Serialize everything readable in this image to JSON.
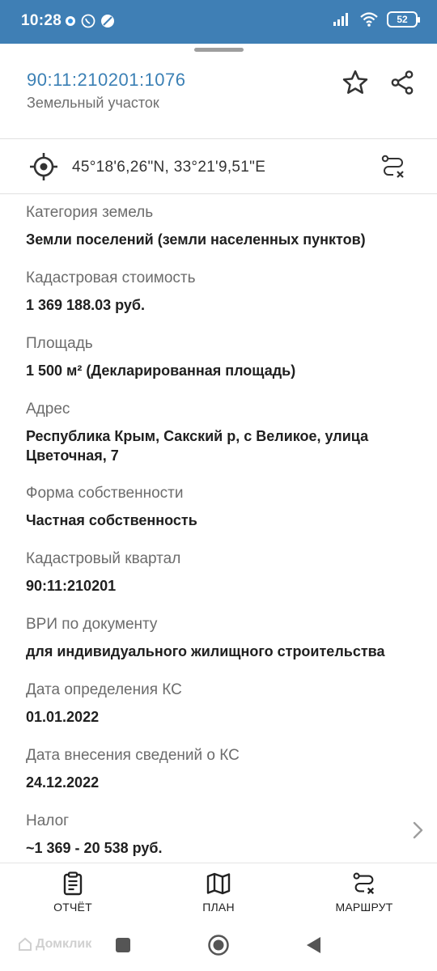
{
  "status_bar": {
    "time": "10:28",
    "battery": "52",
    "icons": [
      "notification-dot-icon",
      "viber-icon",
      "no-disturb-icon",
      "signal-icon",
      "wifi-icon",
      "battery-icon"
    ]
  },
  "header": {
    "cadastral_number": "90:11:210201:1076",
    "object_type": "Земельный участок",
    "accent_color": "#3b80b5"
  },
  "coordinates": {
    "text": "45°18'6,26\"N, 33°21'9,51\"E"
  },
  "fields": [
    {
      "label": "Категория земель",
      "value": "Земли поселений (земли населенных пунктов)"
    },
    {
      "label": "Кадастровая стоимость",
      "value": "1 369 188.03 руб."
    },
    {
      "label": "Площадь",
      "value": "1 500 м² (Декларированная площадь)"
    },
    {
      "label": "Адрес",
      "value": "Республика Крым, Сакский р, с Великое, улица Цветочная, 7"
    },
    {
      "label": "Форма собственности",
      "value": "Частная собственность"
    },
    {
      "label": "Кадастровый квартал",
      "value": "90:11:210201"
    },
    {
      "label": "ВРИ по документу",
      "value": "для индивидуального жилищного строительства"
    },
    {
      "label": "Дата определения КС",
      "value": "01.01.2022"
    },
    {
      "label": "Дата внесения сведений о КС",
      "value": "24.12.2022"
    },
    {
      "label": "Налог",
      "value": "~1 369 - 20 538 руб."
    }
  ],
  "bottom_nav": {
    "report": "ОТЧЁТ",
    "plan": "ПЛАН",
    "route": "МАРШРУТ"
  },
  "watermark": "Домклик"
}
